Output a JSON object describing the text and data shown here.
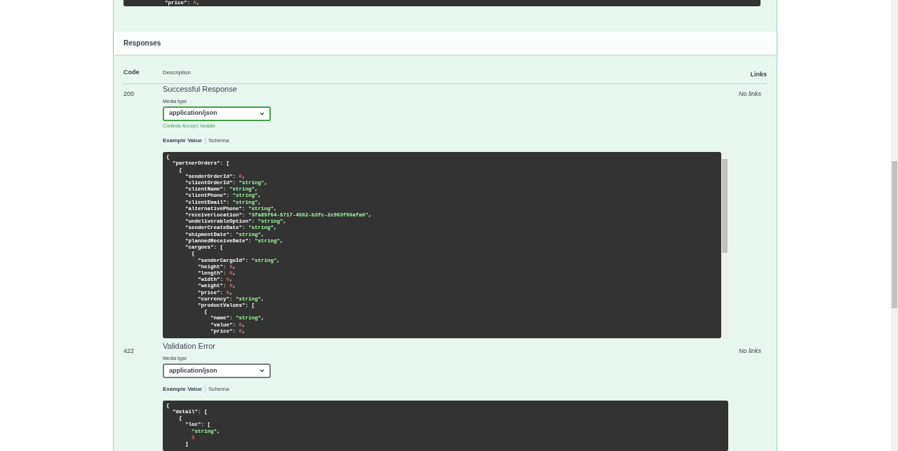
{
  "top_code": {
    "lines": [
      "            \"price\": 0,"
    ]
  },
  "responses": {
    "title": "Responses",
    "columns": [
      "Code",
      "Description",
      "Links"
    ],
    "rows": [
      {
        "code": "200",
        "description": "Successful Response",
        "media_type_label": "Media type",
        "media_type": "application/json",
        "focused": true,
        "controls_note": {
          "before": "Controls ",
          "code": "Accept",
          "after": " header."
        },
        "tabs": [
          {
            "label": "Example Value",
            "selected": true
          },
          {
            "label": "Schema",
            "selected": false
          }
        ],
        "example_lines": [
          "{",
          "  \"partnerOrders\": [",
          "    {",
          "      \"senderOrderId\": 0,",
          "      \"clientOrderId\": \"string\",",
          "      \"clientName\": \"string\",",
          "      \"clientPhone\": \"string\",",
          "      \"clientEmail\": \"string\",",
          "      \"alternativePhone\": \"string\",",
          "      \"receiverLocation\": \"3fa85f64-5717-4562-b3fc-2c963f66afa6\",",
          "      \"undeliverableOption\": \"string\",",
          "      \"senderCreateDate\": \"string\",",
          "      \"shipmentDate\": \"string\",",
          "      \"plannedReceiveDate\": \"string\",",
          "      \"cargoes\": [",
          "        {",
          "          \"senderCargoId\": \"string\",",
          "          \"height\": 0,",
          "          \"length\": 0,",
          "          \"width\": 0,",
          "          \"weight\": 0,",
          "          \"price\": 0,",
          "          \"currency\": \"string\",",
          "          \"productValues\": [",
          "            {",
          "              \"name\": \"string\",",
          "              \"value\": 0,",
          "              \"price\": 0,"
        ],
        "scrollable": true,
        "links": "No links"
      },
      {
        "code": "422",
        "description": "Validation Error",
        "media_type_label": "Media type",
        "media_type": "application/json",
        "focused": false,
        "tabs": [
          {
            "label": "Example Value",
            "selected": true
          },
          {
            "label": "Schema",
            "selected": false
          }
        ],
        "example_lines": [
          "{",
          "  \"detail\": [",
          "    {",
          "      \"loc\": [",
          "        \"string\",",
          "        0",
          "      ]"
        ],
        "scrollable": false,
        "links": "No links"
      }
    ]
  }
}
